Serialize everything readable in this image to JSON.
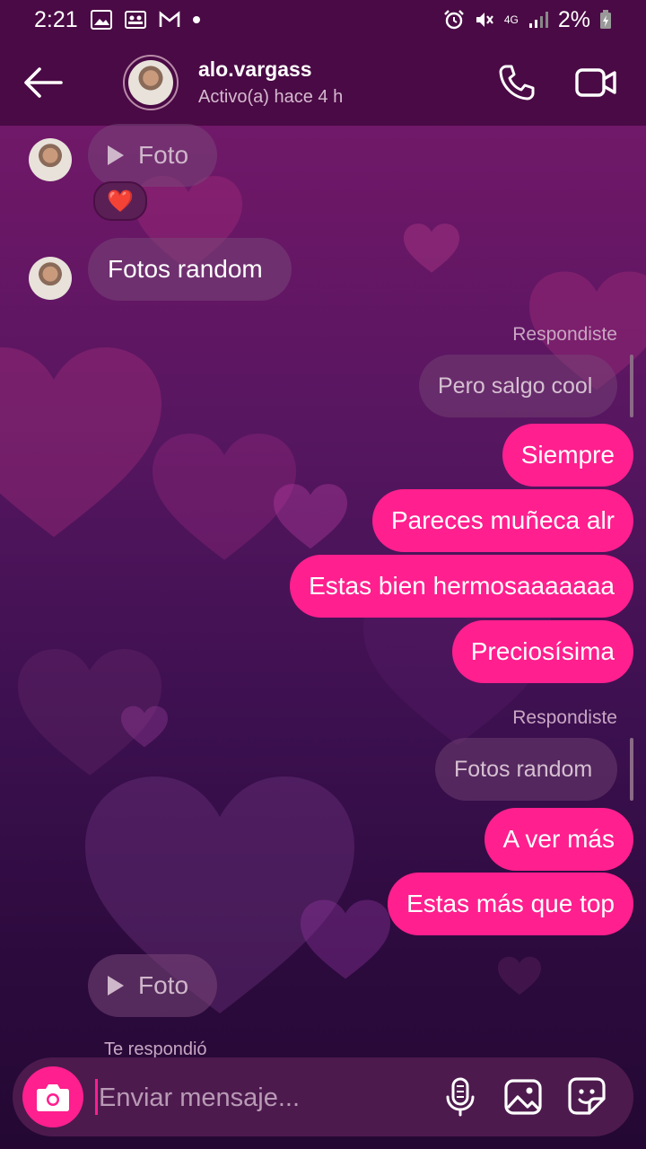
{
  "status_bar": {
    "time": "2:21",
    "battery": "2%",
    "network": "4G"
  },
  "header": {
    "username": "alo.vargass",
    "activity": "Activo(a) hace 4 h"
  },
  "messages": {
    "foto_top": "Foto",
    "reaction": "❤️",
    "in_text": "Fotos random",
    "reply1_label": "Respondiste",
    "reply1_quote": "Pero salgo cool",
    "out1": "Siempre",
    "out2": "Pareces muñeca alr",
    "out3": "Estas bien hermosaaaaaaa",
    "out4": "Preciosísima",
    "reply2_label": "Respondiste",
    "reply2_quote": "Fotos random",
    "out5": "A ver más",
    "out6": "Estas más que top",
    "foto_bottom": "Foto",
    "te_respondio": "Te respondió"
  },
  "composer": {
    "placeholder": "Enviar mensaje..."
  }
}
